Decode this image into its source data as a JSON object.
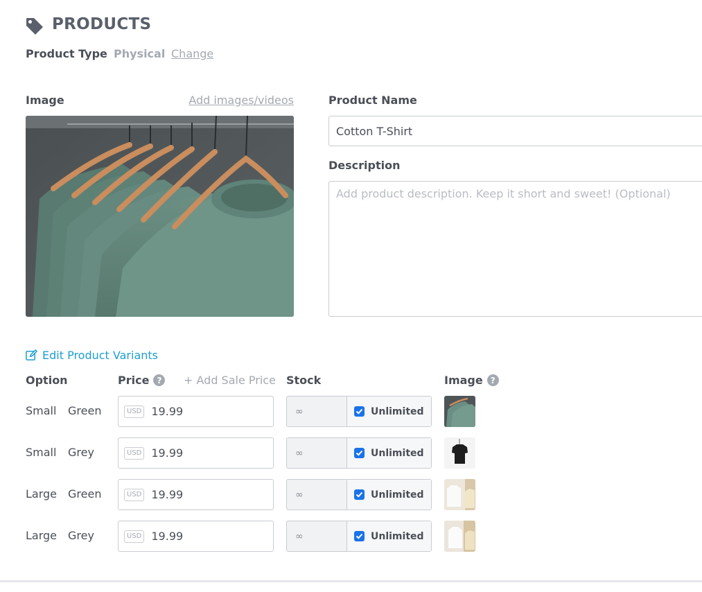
{
  "header": {
    "title": "PRODUCTS",
    "icon": "tag-icon",
    "product_type_label": "Product Type",
    "product_type_value": "Physical",
    "change_link": "Change"
  },
  "image_section": {
    "label": "Image",
    "add_link": "Add images/videos"
  },
  "product_name": {
    "label": "Product Name",
    "value": "Cotton T-Shirt"
  },
  "description": {
    "label": "Description",
    "placeholder": "Add product description. Keep it short and sweet! (Optional)"
  },
  "variants": {
    "edit_link": "Edit Product Variants",
    "headers": {
      "option": "Option",
      "price": "Price",
      "add_sale_price": "+ Add Sale Price",
      "stock": "Stock",
      "image": "Image"
    },
    "rows": [
      {
        "size": "Small",
        "color": "Green",
        "currency": "USD",
        "price": "19.99",
        "stock": "∞",
        "unlimited": "Unlimited"
      },
      {
        "size": "Small",
        "color": "Grey",
        "currency": "USD",
        "price": "19.99",
        "stock": "∞",
        "unlimited": "Unlimited"
      },
      {
        "size": "Large",
        "color": "Green",
        "currency": "USD",
        "price": "19.99",
        "stock": "∞",
        "unlimited": "Unlimited"
      },
      {
        "size": "Large",
        "color": "Grey",
        "currency": "USD",
        "price": "19.99",
        "stock": "∞",
        "unlimited": "Unlimited"
      }
    ]
  },
  "colors": {
    "accent": "#1e9fd0",
    "checkbox": "#1a73e8",
    "muted": "#a4a9b1",
    "text": "#4a4f57"
  }
}
